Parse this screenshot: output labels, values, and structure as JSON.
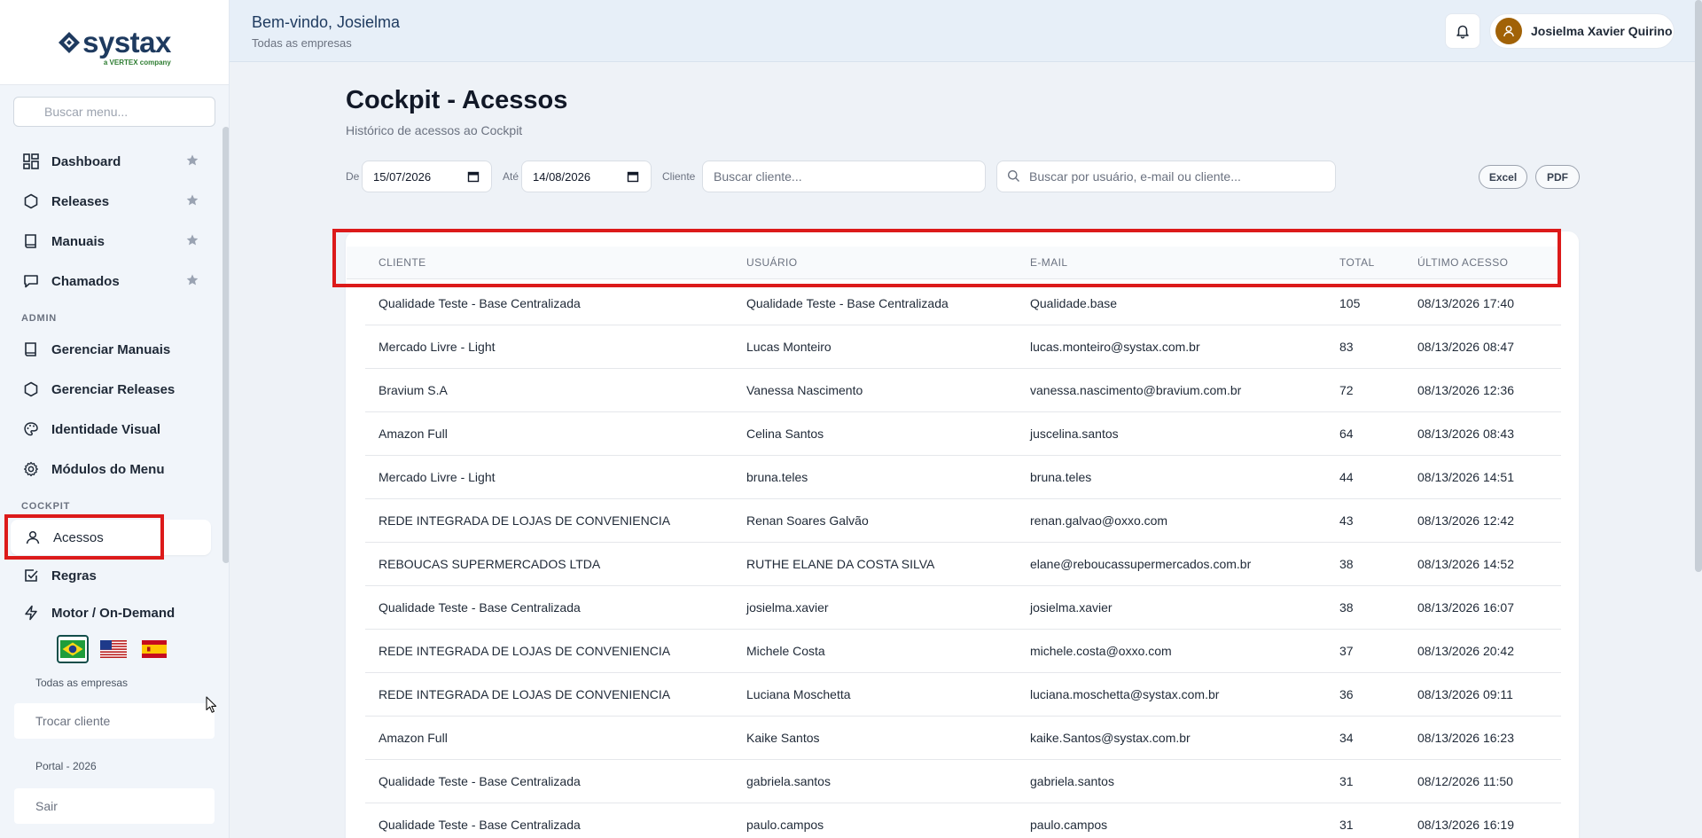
{
  "brand": {
    "name": "systax",
    "tagline": "a VERTEX company"
  },
  "sidebar": {
    "search_placeholder": "Buscar menu...",
    "main_items": [
      {
        "label": "Dashboard",
        "icon": "dashboard-icon"
      },
      {
        "label": "Releases",
        "icon": "hexagon-icon"
      },
      {
        "label": "Manuais",
        "icon": "book-icon"
      },
      {
        "label": "Chamados",
        "icon": "chat-icon"
      }
    ],
    "admin_label": "ADMIN",
    "admin_items": [
      {
        "label": "Gerenciar Manuais",
        "icon": "book-icon"
      },
      {
        "label": "Gerenciar Releases",
        "icon": "hexagon-icon"
      },
      {
        "label": "Identidade Visual",
        "icon": "palette-icon"
      },
      {
        "label": "Módulos do Menu",
        "icon": "gear-icon"
      }
    ],
    "cockpit_label": "COCKPIT",
    "cockpit_items": [
      {
        "label": "Acessos",
        "icon": "user-icon",
        "active": true
      },
      {
        "label": "Regras",
        "icon": "checkbox-icon"
      },
      {
        "label": "Motor / On-Demand",
        "icon": "lightning-icon"
      }
    ],
    "languages": [
      "pt-BR",
      "en-US",
      "es-ES"
    ],
    "company_scope": "Todas as empresas",
    "switch_client_label": "Trocar cliente",
    "portal_label": "Portal - 2026",
    "logout_label": "Sair"
  },
  "header": {
    "welcome": "Bem-vindo, Josielma",
    "subtitle": "Todas as empresas",
    "user_name": "Josielma Xavier Quirino"
  },
  "page": {
    "title": "Cockpit - Acessos",
    "subtitle": "Histórico de acessos ao Cockpit"
  },
  "filters": {
    "from_label": "De",
    "from_value": "15/07/2026",
    "to_label": "Até",
    "to_value": "14/08/2026",
    "client_label": "Cliente",
    "client_placeholder": "Buscar cliente...",
    "search_placeholder": "Buscar por usuário, e-mail ou cliente...",
    "excel_label": "Excel",
    "pdf_label": "PDF"
  },
  "table": {
    "headers": [
      "CLIENTE",
      "USUÁRIO",
      "E-MAIL",
      "TOTAL",
      "ÚLTIMO ACESSO"
    ],
    "rows": [
      [
        "Qualidade Teste - Base Centralizada",
        "Qualidade Teste - Base Centralizada",
        "Qualidade.base",
        "105",
        "08/13/2026 17:40"
      ],
      [
        "Mercado Livre - Light",
        "Lucas Monteiro",
        "lucas.monteiro@systax.com.br",
        "83",
        "08/13/2026 08:47"
      ],
      [
        "Bravium S.A",
        "Vanessa Nascimento",
        "vanessa.nascimento@bravium.com.br",
        "72",
        "08/13/2026 12:36"
      ],
      [
        "Amazon Full",
        "Celina Santos",
        "juscelina.santos",
        "64",
        "08/13/2026 08:43"
      ],
      [
        "Mercado Livre - Light",
        "bruna.teles",
        "bruna.teles",
        "44",
        "08/13/2026 14:51"
      ],
      [
        "REDE INTEGRADA DE LOJAS DE CONVENIENCIA",
        "Renan Soares Galvão",
        "renan.galvao@oxxo.com",
        "43",
        "08/13/2026 12:42"
      ],
      [
        "REBOUCAS SUPERMERCADOS LTDA",
        "RUTHE ELANE DA COSTA SILVA",
        "elane@reboucassupermercados.com.br",
        "38",
        "08/13/2026 14:52"
      ],
      [
        "Qualidade Teste - Base Centralizada",
        "josielma.xavier",
        "josielma.xavier",
        "38",
        "08/13/2026 16:07"
      ],
      [
        "REDE INTEGRADA DE LOJAS DE CONVENIENCIA",
        "Michele Costa",
        "michele.costa@oxxo.com",
        "37",
        "08/13/2026 20:42"
      ],
      [
        "REDE INTEGRADA DE LOJAS DE CONVENIENCIA",
        "Luciana Moschetta",
        "luciana.moschetta@systax.com.br",
        "36",
        "08/13/2026 09:11"
      ],
      [
        "Amazon Full",
        "Kaike Santos",
        "kaike.Santos@systax.com.br",
        "34",
        "08/13/2026 16:23"
      ],
      [
        "Qualidade Teste - Base Centralizada",
        "gabriela.santos",
        "gabriela.santos",
        "31",
        "08/12/2026 11:50"
      ],
      [
        "Qualidade Teste - Base Centralizada",
        "paulo.campos",
        "paulo.campos",
        "31",
        "08/13/2026 16:19"
      ]
    ]
  },
  "colors": {
    "brand_navy": "#1e3a5f",
    "highlight_red": "#dc1a1a",
    "tagline_green": "#2e7d32"
  }
}
